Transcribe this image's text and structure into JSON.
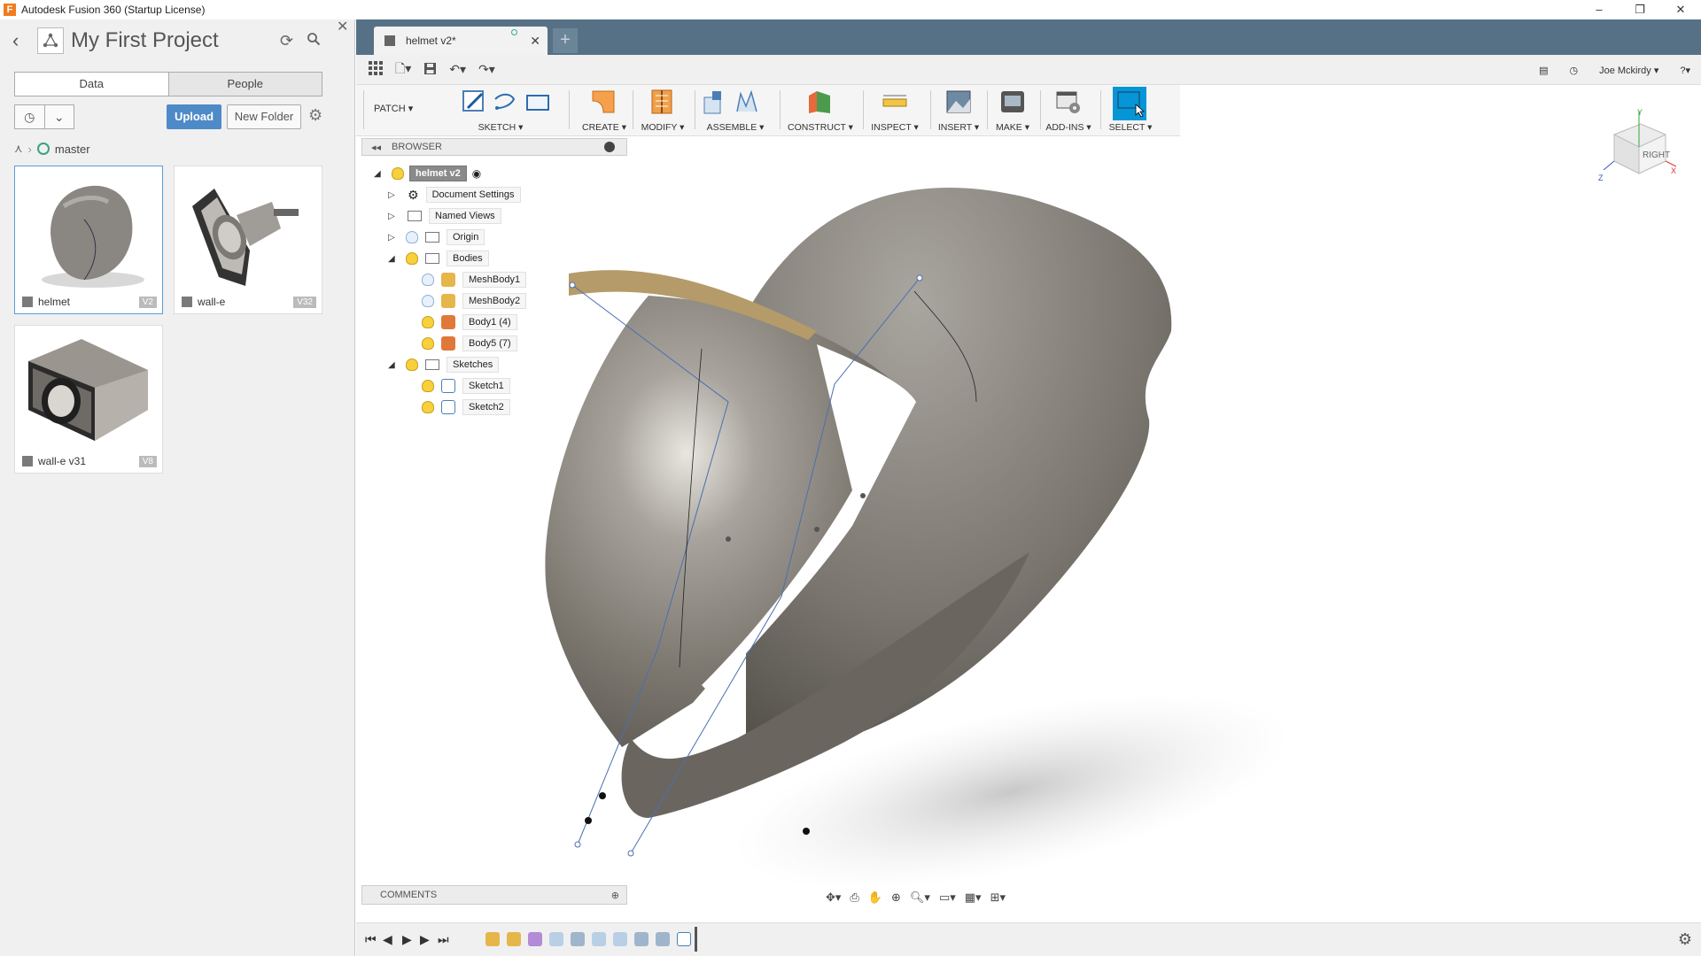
{
  "window": {
    "title": "Autodesk Fusion 360 (Startup License)",
    "controls": [
      "–",
      "❐",
      "✕"
    ]
  },
  "data_panel": {
    "project_title": "My First Project",
    "tabs": {
      "data": "Data",
      "people": "People"
    },
    "upload_label": "Upload",
    "new_folder_label": "New Folder",
    "breadcrumb": "master",
    "files": [
      {
        "name": "helmet",
        "version": "V2"
      },
      {
        "name": "wall-e",
        "version": "V32"
      },
      {
        "name": "wall-e v31",
        "version": "V8"
      }
    ]
  },
  "doc_tab": {
    "title": "helmet v2*"
  },
  "user": {
    "name": "Joe Mckirdy ▾"
  },
  "ribbon": {
    "workspace": "PATCH ▾",
    "groups": [
      {
        "name": "SKETCH ▾"
      },
      {
        "name": "CREATE ▾"
      },
      {
        "name": "MODIFY ▾"
      },
      {
        "name": "ASSEMBLE ▾"
      },
      {
        "name": "CONSTRUCT ▾"
      },
      {
        "name": "INSPECT ▾"
      },
      {
        "name": "INSERT ▾"
      },
      {
        "name": "MAKE ▾"
      },
      {
        "name": "ADD-INS ▾"
      },
      {
        "name": "SELECT ▾"
      }
    ],
    "colors": {
      "accent": "#0696d7",
      "create": "#f5a04b",
      "modify": "#e8842c"
    }
  },
  "browser": {
    "header": "BROWSER",
    "root": "helmet v2",
    "items": {
      "doc_settings": "Document Settings",
      "named_views": "Named Views",
      "origin": "Origin",
      "bodies": "Bodies",
      "mesh1": "MeshBody1",
      "mesh2": "MeshBody2",
      "body1": "Body1 (4)",
      "body5": "Body5 (7)",
      "sketches": "Sketches",
      "sketch1": "Sketch1",
      "sketch2": "Sketch2"
    }
  },
  "comments": {
    "header": "COMMENTS"
  },
  "viewcube": {
    "face": "RIGHT",
    "axes": {
      "x": "X",
      "y": "Y",
      "z": "Z"
    }
  }
}
